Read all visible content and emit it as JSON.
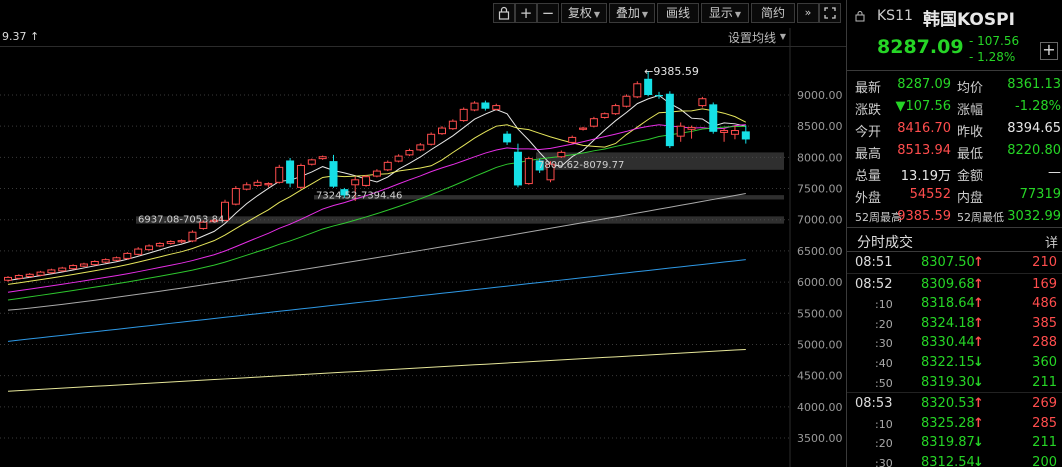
{
  "toolbar": {
    "fuquan": "复权",
    "diejia": "叠加",
    "huaxian": "画线",
    "xianshi": "显示",
    "jianyue": "简约"
  },
  "header": {
    "ma_value": "9.37 ↑",
    "set_ma": "设置均线"
  },
  "chart_data": {
    "type": "candlestick",
    "y_ticks": [
      "9000.00",
      "8500.00",
      "8000.00",
      "7500.00",
      "7000.00",
      "6500.00",
      "6000.00",
      "5500.00",
      "5000.00",
      "4500.00",
      "4000.00",
      "3500.00"
    ],
    "ylim": [
      3300,
      9700
    ],
    "annotations": {
      "high": "←9385.59",
      "range1": "7800.62-8079.77",
      "range2": "7324.52-7394.46",
      "range3": "6937.08-7053.84"
    },
    "zones": [
      [
        7800.62,
        8079.77
      ],
      [
        7324.52,
        7394.46
      ],
      [
        6937.08,
        7053.84
      ]
    ],
    "colors": {
      "up": "#ff4d4d",
      "down": "#16e0e6",
      "ma5": "#ffffff",
      "ma10": "#ffff66",
      "ma20": "#ff33ff",
      "ma30": "#33dd33",
      "ma60": "#bbbbbb",
      "ma120": "#33aaff",
      "ma250": "#ffffaa"
    },
    "candles": [
      {
        "o": 6030,
        "c": 6075,
        "h": 6095,
        "l": 6005
      },
      {
        "o": 6060,
        "c": 6105,
        "h": 6125,
        "l": 6040
      },
      {
        "o": 6090,
        "c": 6125,
        "h": 6145,
        "l": 6075
      },
      {
        "o": 6110,
        "c": 6160,
        "h": 6180,
        "l": 6095
      },
      {
        "o": 6150,
        "c": 6195,
        "h": 6215,
        "l": 6135
      },
      {
        "o": 6180,
        "c": 6225,
        "h": 6245,
        "l": 6165
      },
      {
        "o": 6215,
        "c": 6265,
        "h": 6285,
        "l": 6200
      },
      {
        "o": 6255,
        "c": 6290,
        "h": 6310,
        "l": 6240
      },
      {
        "o": 6280,
        "c": 6330,
        "h": 6350,
        "l": 6265
      },
      {
        "o": 6320,
        "c": 6360,
        "h": 6380,
        "l": 6305
      },
      {
        "o": 6350,
        "c": 6390,
        "h": 6410,
        "l": 6335
      },
      {
        "o": 6380,
        "c": 6460,
        "h": 6480,
        "l": 6360
      },
      {
        "o": 6445,
        "c": 6530,
        "h": 6560,
        "l": 6430
      },
      {
        "o": 6520,
        "c": 6580,
        "h": 6605,
        "l": 6505
      },
      {
        "o": 6580,
        "c": 6620,
        "h": 6640,
        "l": 6560
      },
      {
        "o": 6620,
        "c": 6650,
        "h": 6670,
        "l": 6600
      },
      {
        "o": 6645,
        "c": 6665,
        "h": 6685,
        "l": 6625
      },
      {
        "o": 6660,
        "c": 6800,
        "h": 6830,
        "l": 6640
      },
      {
        "o": 6860,
        "c": 6960,
        "h": 6990,
        "l": 6840
      },
      {
        "o": 6970,
        "c": 6990,
        "h": 7010,
        "l": 6950
      },
      {
        "o": 6990,
        "c": 7280,
        "h": 7320,
        "l": 6975
      },
      {
        "o": 7250,
        "c": 7500,
        "h": 7540,
        "l": 7230
      },
      {
        "o": 7490,
        "c": 7560,
        "h": 7600,
        "l": 7470
      },
      {
        "o": 7550,
        "c": 7600,
        "h": 7640,
        "l": 7530
      },
      {
        "o": 7560,
        "c": 7580,
        "h": 7600,
        "l": 7520
      },
      {
        "o": 7600,
        "c": 7840,
        "h": 7880,
        "l": 7580
      },
      {
        "o": 7950,
        "c": 7580,
        "h": 7990,
        "l": 7520
      },
      {
        "o": 7520,
        "c": 7870,
        "h": 7900,
        "l": 7490
      },
      {
        "o": 7890,
        "c": 7960,
        "h": 7980,
        "l": 7870
      },
      {
        "o": 7980,
        "c": 8010,
        "h": 8030,
        "l": 7960
      },
      {
        "o": 7940,
        "c": 7530,
        "h": 8040,
        "l": 7510
      },
      {
        "o": 7490,
        "c": 7390,
        "h": 7510,
        "l": 7350
      },
      {
        "o": 7560,
        "c": 7640,
        "h": 7690,
        "l": 7300
      },
      {
        "o": 7550,
        "c": 7690,
        "h": 7720,
        "l": 7530
      },
      {
        "o": 7700,
        "c": 7780,
        "h": 7810,
        "l": 7680
      },
      {
        "o": 7800,
        "c": 7920,
        "h": 7950,
        "l": 7780
      },
      {
        "o": 7940,
        "c": 8020,
        "h": 8050,
        "l": 7920
      },
      {
        "o": 8040,
        "c": 8110,
        "h": 8140,
        "l": 8020
      },
      {
        "o": 8120,
        "c": 8200,
        "h": 8230,
        "l": 8100
      },
      {
        "o": 8210,
        "c": 8370,
        "h": 8400,
        "l": 8190
      },
      {
        "o": 8380,
        "c": 8470,
        "h": 8500,
        "l": 8360
      },
      {
        "o": 8460,
        "c": 8580,
        "h": 8610,
        "l": 8440
      },
      {
        "o": 8590,
        "c": 8770,
        "h": 8800,
        "l": 8570
      },
      {
        "o": 8760,
        "c": 8870,
        "h": 8900,
        "l": 8740
      },
      {
        "o": 8880,
        "c": 8780,
        "h": 8910,
        "l": 8750
      },
      {
        "o": 8770,
        "c": 8830,
        "h": 8860,
        "l": 8750
      },
      {
        "o": 8380,
        "c": 8240,
        "h": 8420,
        "l": 8200
      },
      {
        "o": 8090,
        "c": 7550,
        "h": 8220,
        "l": 7520
      },
      {
        "o": 7580,
        "c": 7980,
        "h": 8010,
        "l": 7560
      },
      {
        "o": 7950,
        "c": 7790,
        "h": 7980,
        "l": 7750
      },
      {
        "o": 7640,
        "c": 7890,
        "h": 7940,
        "l": 7600
      },
      {
        "o": 8010,
        "c": 8080,
        "h": 8110,
        "l": 7990
      },
      {
        "o": 8240,
        "c": 8320,
        "h": 8350,
        "l": 8220
      },
      {
        "o": 8450,
        "c": 8470,
        "h": 8490,
        "l": 8430
      },
      {
        "o": 8500,
        "c": 8620,
        "h": 8650,
        "l": 8480
      },
      {
        "o": 8640,
        "c": 8700,
        "h": 8720,
        "l": 8620
      },
      {
        "o": 8700,
        "c": 8830,
        "h": 8860,
        "l": 8680
      },
      {
        "o": 8820,
        "c": 8980,
        "h": 9010,
        "l": 8800
      },
      {
        "o": 8970,
        "c": 9180,
        "h": 9220,
        "l": 8950
      },
      {
        "o": 9260,
        "c": 9000,
        "h": 9385.59,
        "l": 8980
      },
      {
        "o": 9000,
        "c": 8980,
        "h": 9050,
        "l": 8940
      },
      {
        "o": 9020,
        "c": 8180,
        "h": 9060,
        "l": 8150
      },
      {
        "o": 8340,
        "c": 8500,
        "h": 8560,
        "l": 8250
      },
      {
        "o": 8450,
        "c": 8480,
        "h": 8510,
        "l": 8300
      },
      {
        "o": 8830,
        "c": 8940,
        "h": 8970,
        "l": 8800
      },
      {
        "o": 8850,
        "c": 8410,
        "h": 8880,
        "l": 8380
      },
      {
        "o": 8400,
        "c": 8430,
        "h": 8460,
        "l": 8250
      },
      {
        "o": 8370,
        "c": 8430,
        "h": 8510,
        "l": 8290
      },
      {
        "o": 8416.7,
        "c": 8287.09,
        "h": 8513.94,
        "l": 8220.8
      }
    ]
  },
  "panel": {
    "code": "KS11",
    "name": "韩国KOSPI",
    "price": "8287.09",
    "change": "- 107.56",
    "pct": "- 1.28%",
    "quote": [
      {
        "l1": "最新",
        "v1": "8287.09",
        "c1": "green",
        "l2": "均价",
        "v2": "8361.13",
        "c2": "green"
      },
      {
        "l1": "涨跌",
        "v1": "▼107.56",
        "c1": "green",
        "l2": "涨幅",
        "v2": "-1.28%",
        "c2": "green"
      },
      {
        "l1": "今开",
        "v1": "8416.70",
        "c1": "red",
        "l2": "昨收",
        "v2": "8394.65",
        "c2": "white"
      },
      {
        "l1": "最高",
        "v1": "8513.94",
        "c1": "red",
        "l2": "最低",
        "v2": "8220.80",
        "c2": "green"
      },
      {
        "l1": "总量",
        "v1": "13.19万",
        "c1": "white",
        "l2": "金额",
        "v2": "—",
        "c2": "white"
      },
      {
        "l1": "外盘",
        "v1": "54552",
        "c1": "red",
        "l2": "内盘",
        "v2": "77319",
        "c2": "green"
      },
      {
        "l1": "52周最高",
        "v1": "9385.59",
        "c1": "red",
        "l2": "52周最低",
        "v2": "3032.99",
        "c2": "green"
      }
    ],
    "ts_title": "分时成交",
    "ts_detail": "详",
    "ticks": [
      {
        "time": "08:51",
        "price": "8307.50",
        "dir": "↑",
        "vol": "210"
      },
      {
        "time": "08:52",
        "price": "8309.68",
        "dir": "↑",
        "vol": "169"
      },
      {
        "time": ":10",
        "price": "8318.64",
        "dir": "↑",
        "vol": "486"
      },
      {
        "time": ":20",
        "price": "8324.18",
        "dir": "↑",
        "vol": "385"
      },
      {
        "time": ":30",
        "price": "8330.44",
        "dir": "↑",
        "vol": "288"
      },
      {
        "time": ":40",
        "price": "8322.15",
        "dir": "↓",
        "vol": "360"
      },
      {
        "time": ":50",
        "price": "8319.30",
        "dir": "↓",
        "vol": "211"
      },
      {
        "time": "08:53",
        "price": "8320.53",
        "dir": "↑",
        "vol": "269"
      },
      {
        "time": ":10",
        "price": "8325.28",
        "dir": "↑",
        "vol": "285"
      },
      {
        "time": ":20",
        "price": "8319.87",
        "dir": "↓",
        "vol": "211"
      },
      {
        "time": ":30",
        "price": "8312.54",
        "dir": "↓",
        "vol": "200"
      }
    ]
  }
}
